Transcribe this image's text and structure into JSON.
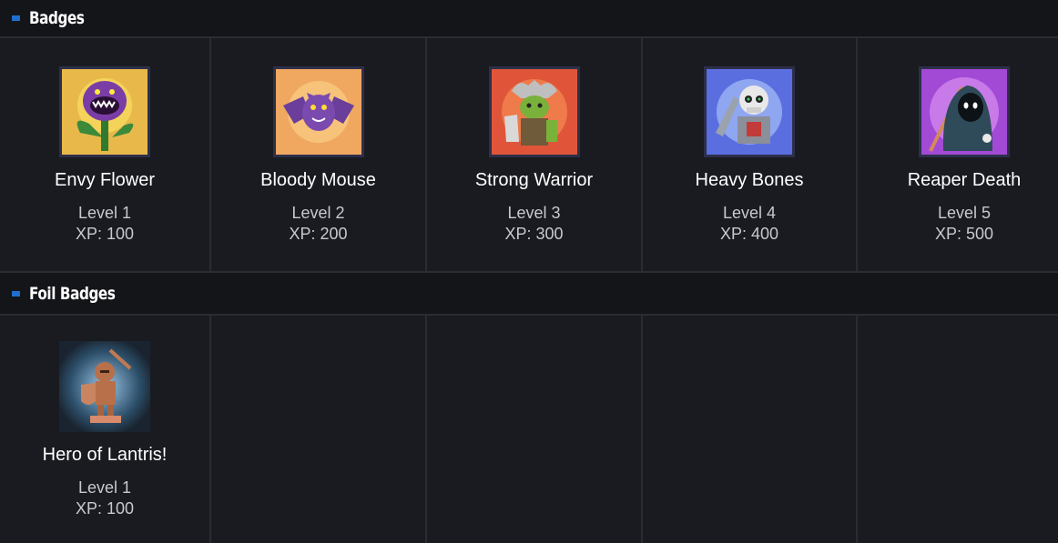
{
  "sections": [
    {
      "title": "Badges",
      "badges": [
        {
          "name": "Envy Flower",
          "level": "Level 1",
          "xp": "XP: 100",
          "icon": "envy-flower-icon"
        },
        {
          "name": "Bloody Mouse",
          "level": "Level 2",
          "xp": "XP: 200",
          "icon": "bloody-mouse-icon"
        },
        {
          "name": "Strong Warrior",
          "level": "Level 3",
          "xp": "XP: 300",
          "icon": "strong-warrior-icon"
        },
        {
          "name": "Heavy Bones",
          "level": "Level 4",
          "xp": "XP: 400",
          "icon": "heavy-bones-icon"
        },
        {
          "name": "Reaper Death",
          "level": "Level 5",
          "xp": "XP: 500",
          "icon": "reaper-death-icon"
        }
      ]
    },
    {
      "title": "Foil Badges",
      "badges": [
        {
          "name": "Hero of Lantris!",
          "level": "Level 1",
          "xp": "XP: 100",
          "icon": "hero-of-lantris-icon"
        }
      ]
    }
  ],
  "colors": {
    "accent": "#1f6fd1",
    "background": "#191b20",
    "header": "#141519"
  }
}
